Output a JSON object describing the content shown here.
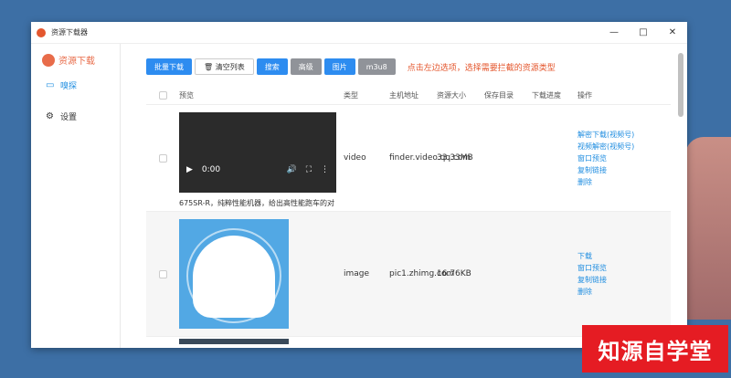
{
  "window": {
    "title": "资源下载器",
    "controls": [
      "—",
      "□",
      "✕"
    ]
  },
  "sidebar": {
    "logo_text": "资源下载",
    "items": [
      {
        "label": "嗅探",
        "icon": "monitor-icon"
      },
      {
        "label": "设置",
        "icon": "gear-icon"
      }
    ]
  },
  "toolbar": {
    "batch_download": "批量下载",
    "clear_list": "清空列表",
    "search": "搜索",
    "hd": "高级",
    "image": "图片",
    "m3u8": "m3u8",
    "hint": "点击左边选项，选择需要拦截的资源类型"
  },
  "table": {
    "headers": [
      "预览",
      "类型",
      "主机地址",
      "资源大小",
      "保存目录",
      "下载进度",
      "操作"
    ],
    "rows": [
      {
        "type": "video",
        "host": "finder.video.qq.com",
        "size": "33.33MB",
        "time": "0:00",
        "caption": "675SR-R，纯粹性能机器，给出高性能跑车的对",
        "ops": [
          "解密下载(视频号)",
          "视频解密(视频号)",
          "窗口预览",
          "复制链接",
          "删除"
        ]
      },
      {
        "type": "image",
        "host": "pic1.zhimg.com",
        "size": "16.76KB",
        "ops": [
          "下载",
          "窗口预览",
          "复制链接",
          "删除"
        ]
      }
    ]
  },
  "watermark": "知源自学堂",
  "colors": {
    "primary": "#2d8cf0",
    "accent": "#e4572e",
    "gray_btn": "#909399"
  }
}
